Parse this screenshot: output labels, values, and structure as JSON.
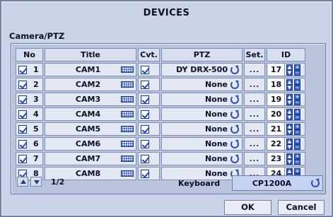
{
  "window": {
    "title": "DEVICES"
  },
  "section": {
    "label": "Camera/PTZ"
  },
  "table": {
    "headers": {
      "no": "No",
      "title": "Title",
      "cvt": "Cvt.",
      "ptz": "PTZ",
      "set": "Set.",
      "id": "ID"
    },
    "rows": [
      {
        "no": "1",
        "title": "CAM1",
        "cvt": true,
        "ptz": "DY DRX-500",
        "set": "...",
        "id": "17"
      },
      {
        "no": "2",
        "title": "CAM2",
        "cvt": true,
        "ptz": "None",
        "set": "...",
        "id": "18"
      },
      {
        "no": "3",
        "title": "CAM3",
        "cvt": true,
        "ptz": "None",
        "set": "...",
        "id": "19"
      },
      {
        "no": "4",
        "title": "CAM4",
        "cvt": true,
        "ptz": "None",
        "set": "...",
        "id": "20"
      },
      {
        "no": "5",
        "title": "CAM5",
        "cvt": true,
        "ptz": "None",
        "set": "...",
        "id": "21"
      },
      {
        "no": "6",
        "title": "CAM6",
        "cvt": true,
        "ptz": "None",
        "set": "...",
        "id": "22"
      },
      {
        "no": "7",
        "title": "CAM7",
        "cvt": true,
        "ptz": "None",
        "set": "...",
        "id": "23"
      },
      {
        "no": "8",
        "title": "CAM8",
        "cvt": true,
        "ptz": "None",
        "set": "...",
        "id": "24"
      }
    ]
  },
  "pager": {
    "text": "1/2"
  },
  "keyboard": {
    "label": "Keyboard",
    "value": "CP1200A"
  },
  "buttons": {
    "ok": "OK",
    "cancel": "Cancel"
  },
  "colors": {
    "background": "#c9d2e6",
    "panel": "#b8c3de",
    "accent": "#2a4fb8"
  },
  "icons": {
    "row_check": "checkbox-checked-icon",
    "title_edit": "keyboard-icon",
    "ptz_select": "cycle-icon",
    "id_spin": "spinner-icon"
  }
}
